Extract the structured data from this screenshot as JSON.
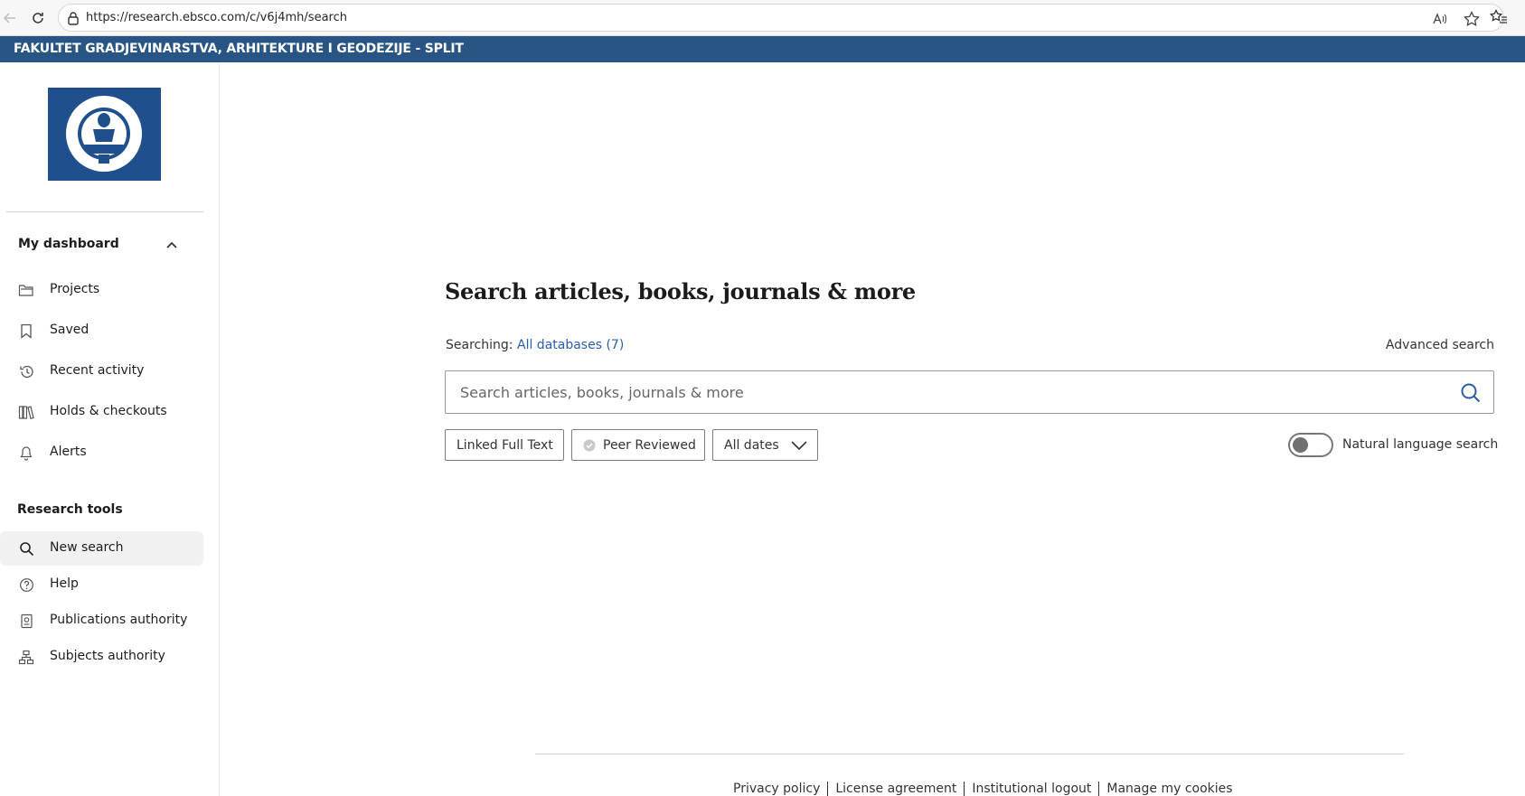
{
  "browser": {
    "url": "https://research.ebsco.com/c/v6j4mh/search"
  },
  "banner": {
    "org_name": "FAKULTET GRADJEVINARSTVA, ARHITEKTURE I GEODEZIJE - SPLIT"
  },
  "sidebar": {
    "dashboard_heading": "My dashboard",
    "dashboard_items": [
      {
        "label": "Projects",
        "icon": "folder-icon"
      },
      {
        "label": "Saved",
        "icon": "bookmark-icon"
      },
      {
        "label": "Recent activity",
        "icon": "history-icon"
      },
      {
        "label": "Holds & checkouts",
        "icon": "books-icon"
      },
      {
        "label": "Alerts",
        "icon": "bell-icon"
      }
    ],
    "tools_heading": "Research tools",
    "tools_items": [
      {
        "label": "New search",
        "icon": "search-icon",
        "active": true
      },
      {
        "label": "Help",
        "icon": "help-icon"
      },
      {
        "label": "Publications authority",
        "icon": "publication-icon"
      },
      {
        "label": "Subjects authority",
        "icon": "hierarchy-icon"
      }
    ]
  },
  "main": {
    "title": "Search articles, books, journals & more",
    "searching_label": "Searching:",
    "databases_link": "All databases (7)",
    "advanced_search": "Advanced search",
    "search_placeholder": "Search articles, books, journals & more",
    "filters": {
      "linked_full_text": "Linked Full Text",
      "peer_reviewed": "Peer Reviewed",
      "dates": "All dates"
    },
    "natural_language": {
      "label": "Natural language search",
      "enabled": false
    }
  },
  "footer": {
    "links": [
      "Privacy policy",
      "License agreement",
      "Institutional logout",
      "Manage my cookies"
    ]
  },
  "colors": {
    "banner": "#285583",
    "link": "#2a5fa7"
  }
}
